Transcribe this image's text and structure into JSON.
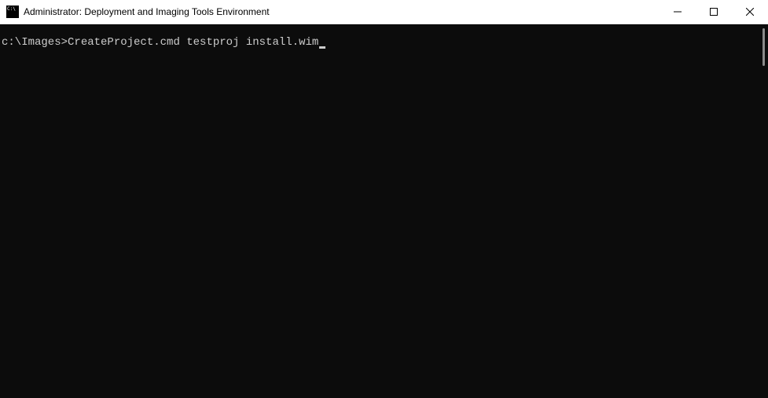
{
  "window": {
    "title": "Administrator: Deployment and Imaging Tools Environment"
  },
  "terminal": {
    "prompt": "c:\\Images>",
    "command": "CreateProject.cmd testproj install.wim"
  }
}
